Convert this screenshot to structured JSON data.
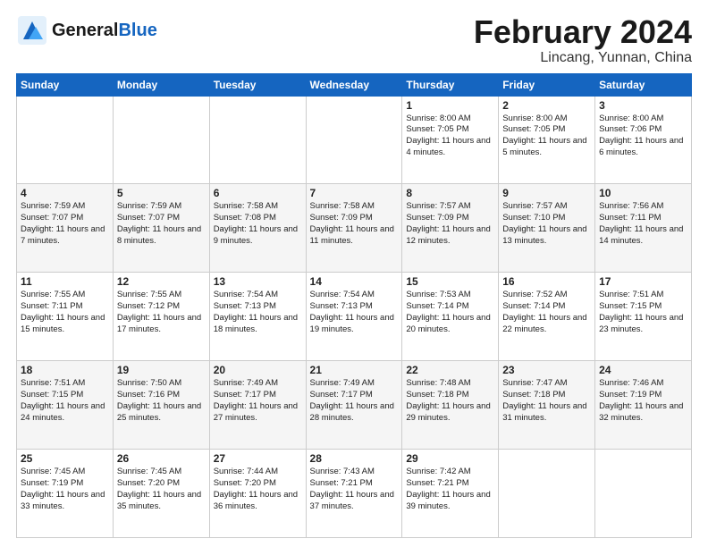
{
  "header": {
    "logo_line1": "General",
    "logo_line2": "Blue",
    "month_title": "February 2024",
    "location": "Lincang, Yunnan, China"
  },
  "days_of_week": [
    "Sunday",
    "Monday",
    "Tuesday",
    "Wednesday",
    "Thursday",
    "Friday",
    "Saturday"
  ],
  "weeks": [
    [
      {
        "day": "",
        "info": ""
      },
      {
        "day": "",
        "info": ""
      },
      {
        "day": "",
        "info": ""
      },
      {
        "day": "",
        "info": ""
      },
      {
        "day": "1",
        "info": "Sunrise: 8:00 AM\nSunset: 7:05 PM\nDaylight: 11 hours\nand 4 minutes."
      },
      {
        "day": "2",
        "info": "Sunrise: 8:00 AM\nSunset: 7:05 PM\nDaylight: 11 hours\nand 5 minutes."
      },
      {
        "day": "3",
        "info": "Sunrise: 8:00 AM\nSunset: 7:06 PM\nDaylight: 11 hours\nand 6 minutes."
      }
    ],
    [
      {
        "day": "4",
        "info": "Sunrise: 7:59 AM\nSunset: 7:07 PM\nDaylight: 11 hours\nand 7 minutes."
      },
      {
        "day": "5",
        "info": "Sunrise: 7:59 AM\nSunset: 7:07 PM\nDaylight: 11 hours\nand 8 minutes."
      },
      {
        "day": "6",
        "info": "Sunrise: 7:58 AM\nSunset: 7:08 PM\nDaylight: 11 hours\nand 9 minutes."
      },
      {
        "day": "7",
        "info": "Sunrise: 7:58 AM\nSunset: 7:09 PM\nDaylight: 11 hours\nand 11 minutes."
      },
      {
        "day": "8",
        "info": "Sunrise: 7:57 AM\nSunset: 7:09 PM\nDaylight: 11 hours\nand 12 minutes."
      },
      {
        "day": "9",
        "info": "Sunrise: 7:57 AM\nSunset: 7:10 PM\nDaylight: 11 hours\nand 13 minutes."
      },
      {
        "day": "10",
        "info": "Sunrise: 7:56 AM\nSunset: 7:11 PM\nDaylight: 11 hours\nand 14 minutes."
      }
    ],
    [
      {
        "day": "11",
        "info": "Sunrise: 7:55 AM\nSunset: 7:11 PM\nDaylight: 11 hours\nand 15 minutes."
      },
      {
        "day": "12",
        "info": "Sunrise: 7:55 AM\nSunset: 7:12 PM\nDaylight: 11 hours\nand 17 minutes."
      },
      {
        "day": "13",
        "info": "Sunrise: 7:54 AM\nSunset: 7:13 PM\nDaylight: 11 hours\nand 18 minutes."
      },
      {
        "day": "14",
        "info": "Sunrise: 7:54 AM\nSunset: 7:13 PM\nDaylight: 11 hours\nand 19 minutes."
      },
      {
        "day": "15",
        "info": "Sunrise: 7:53 AM\nSunset: 7:14 PM\nDaylight: 11 hours\nand 20 minutes."
      },
      {
        "day": "16",
        "info": "Sunrise: 7:52 AM\nSunset: 7:14 PM\nDaylight: 11 hours\nand 22 minutes."
      },
      {
        "day": "17",
        "info": "Sunrise: 7:51 AM\nSunset: 7:15 PM\nDaylight: 11 hours\nand 23 minutes."
      }
    ],
    [
      {
        "day": "18",
        "info": "Sunrise: 7:51 AM\nSunset: 7:15 PM\nDaylight: 11 hours\nand 24 minutes."
      },
      {
        "day": "19",
        "info": "Sunrise: 7:50 AM\nSunset: 7:16 PM\nDaylight: 11 hours\nand 25 minutes."
      },
      {
        "day": "20",
        "info": "Sunrise: 7:49 AM\nSunset: 7:17 PM\nDaylight: 11 hours\nand 27 minutes."
      },
      {
        "day": "21",
        "info": "Sunrise: 7:49 AM\nSunset: 7:17 PM\nDaylight: 11 hours\nand 28 minutes."
      },
      {
        "day": "22",
        "info": "Sunrise: 7:48 AM\nSunset: 7:18 PM\nDaylight: 11 hours\nand 29 minutes."
      },
      {
        "day": "23",
        "info": "Sunrise: 7:47 AM\nSunset: 7:18 PM\nDaylight: 11 hours\nand 31 minutes."
      },
      {
        "day": "24",
        "info": "Sunrise: 7:46 AM\nSunset: 7:19 PM\nDaylight: 11 hours\nand 32 minutes."
      }
    ],
    [
      {
        "day": "25",
        "info": "Sunrise: 7:45 AM\nSunset: 7:19 PM\nDaylight: 11 hours\nand 33 minutes."
      },
      {
        "day": "26",
        "info": "Sunrise: 7:45 AM\nSunset: 7:20 PM\nDaylight: 11 hours\nand 35 minutes."
      },
      {
        "day": "27",
        "info": "Sunrise: 7:44 AM\nSunset: 7:20 PM\nDaylight: 11 hours\nand 36 minutes."
      },
      {
        "day": "28",
        "info": "Sunrise: 7:43 AM\nSunset: 7:21 PM\nDaylight: 11 hours\nand 37 minutes."
      },
      {
        "day": "29",
        "info": "Sunrise: 7:42 AM\nSunset: 7:21 PM\nDaylight: 11 hours\nand 39 minutes."
      },
      {
        "day": "",
        "info": ""
      },
      {
        "day": "",
        "info": ""
      }
    ]
  ]
}
